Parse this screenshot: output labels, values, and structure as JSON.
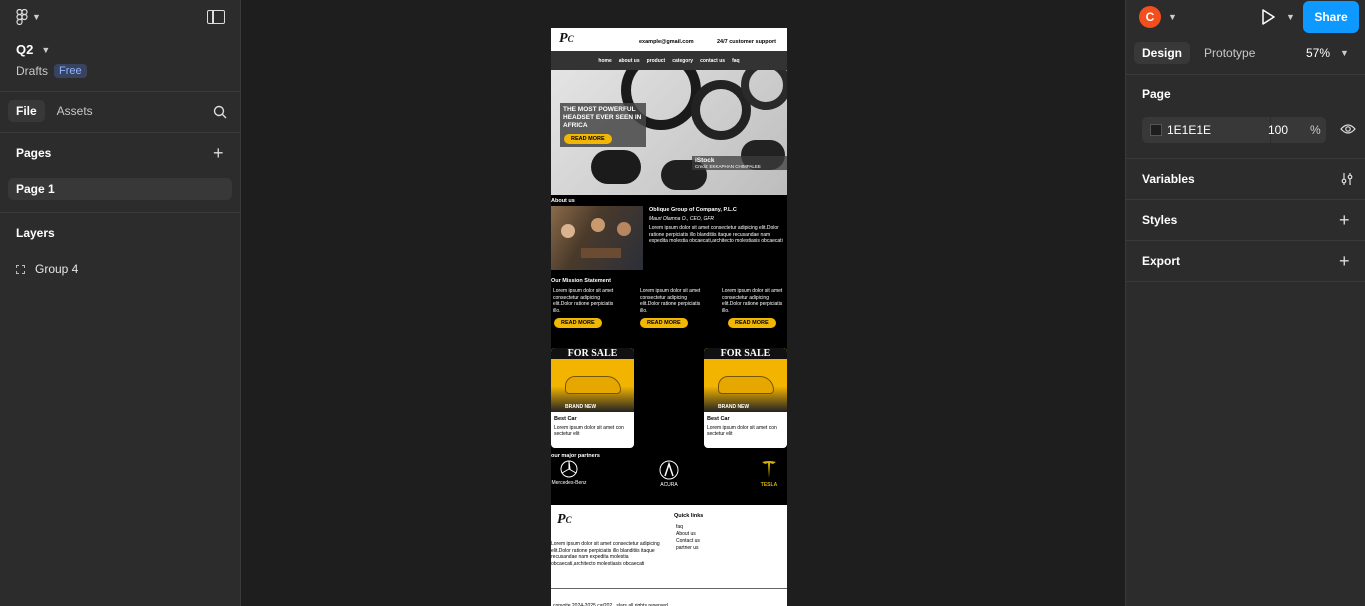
{
  "app": {
    "file_name": "Q2",
    "location": "Drafts",
    "plan_badge": "Free"
  },
  "left_panel": {
    "tabs": [
      {
        "label": "File"
      },
      {
        "label": "Assets"
      }
    ],
    "pages_title": "Pages",
    "pages": [
      {
        "label": "Page 1"
      }
    ],
    "layers_title": "Layers",
    "layers": [
      {
        "label": "Group 4",
        "icon": "group-icon"
      }
    ]
  },
  "right_panel": {
    "avatar_initial": "C",
    "share_label": "Share",
    "tabs": [
      {
        "label": "Design"
      },
      {
        "label": "Prototype"
      }
    ],
    "zoom": "57%",
    "page_section": "Page",
    "page_fill_hex": "1E1E1E",
    "page_fill_opacity": "100",
    "page_fill_pct": "%",
    "variables_label": "Variables",
    "styles_label": "Styles",
    "export_label": "Export"
  },
  "design": {
    "email": "example@gmail.com",
    "support": "24/7 customer support",
    "nav": [
      "home",
      "about us",
      "product",
      "category",
      "contact us",
      "faq"
    ],
    "hero_title": "THE MOST POWERFUL HEADSET EVER SEEN IN AFRICA",
    "read_more": "READ MORE",
    "istock": "iStock",
    "istock_credit": "Credit: EKKAPHAN CHIMPALEE",
    "about_title": "About us",
    "about_company": "Oblique Group of Company, P.L.C",
    "about_ceo": "Mauri Olamna O., CEO, GFR",
    "about_lorem": "Lorem ipsum dolor sit amet consectetur adipicing elit.Dolor ratione perpiciatis illo blanditiis itaque recusandae nam expedita molestia obcaecati,architecto molestiasis obcaecati",
    "mission_title": "Our Mission Statement",
    "mission_text": "Lorem ipsum dolor sit amet consectetur adipicing elit.Dolor ratione perpiciatis illo.",
    "car_for_sale": "FOR SALE",
    "car_brand_new": "BRAND NEW",
    "car_name": "Best Car",
    "car_desc": "Lorem ipsum dolor sit amet con sectetur elit",
    "partners_title": "our major  partners",
    "partner_mercedes": "Mercedes-Benz",
    "partner_acura": "ACURA",
    "partner_tesla": "TESLA",
    "footer_lorem": "Lorem ipsum dolor sit amet consectetur adipicing elit.Dolor ratione perpiciatis illo blanditiis itaque recusandae nam expedita molestia obcaecati,architecto molestiasis obcaecati",
    "quick_links_title": "Quick links",
    "quick_links": [
      "faq",
      "About us",
      "Contact us",
      "partner us"
    ],
    "copyright": "copyrite 2024-2025 cat202 . slars all rights reserved"
  }
}
